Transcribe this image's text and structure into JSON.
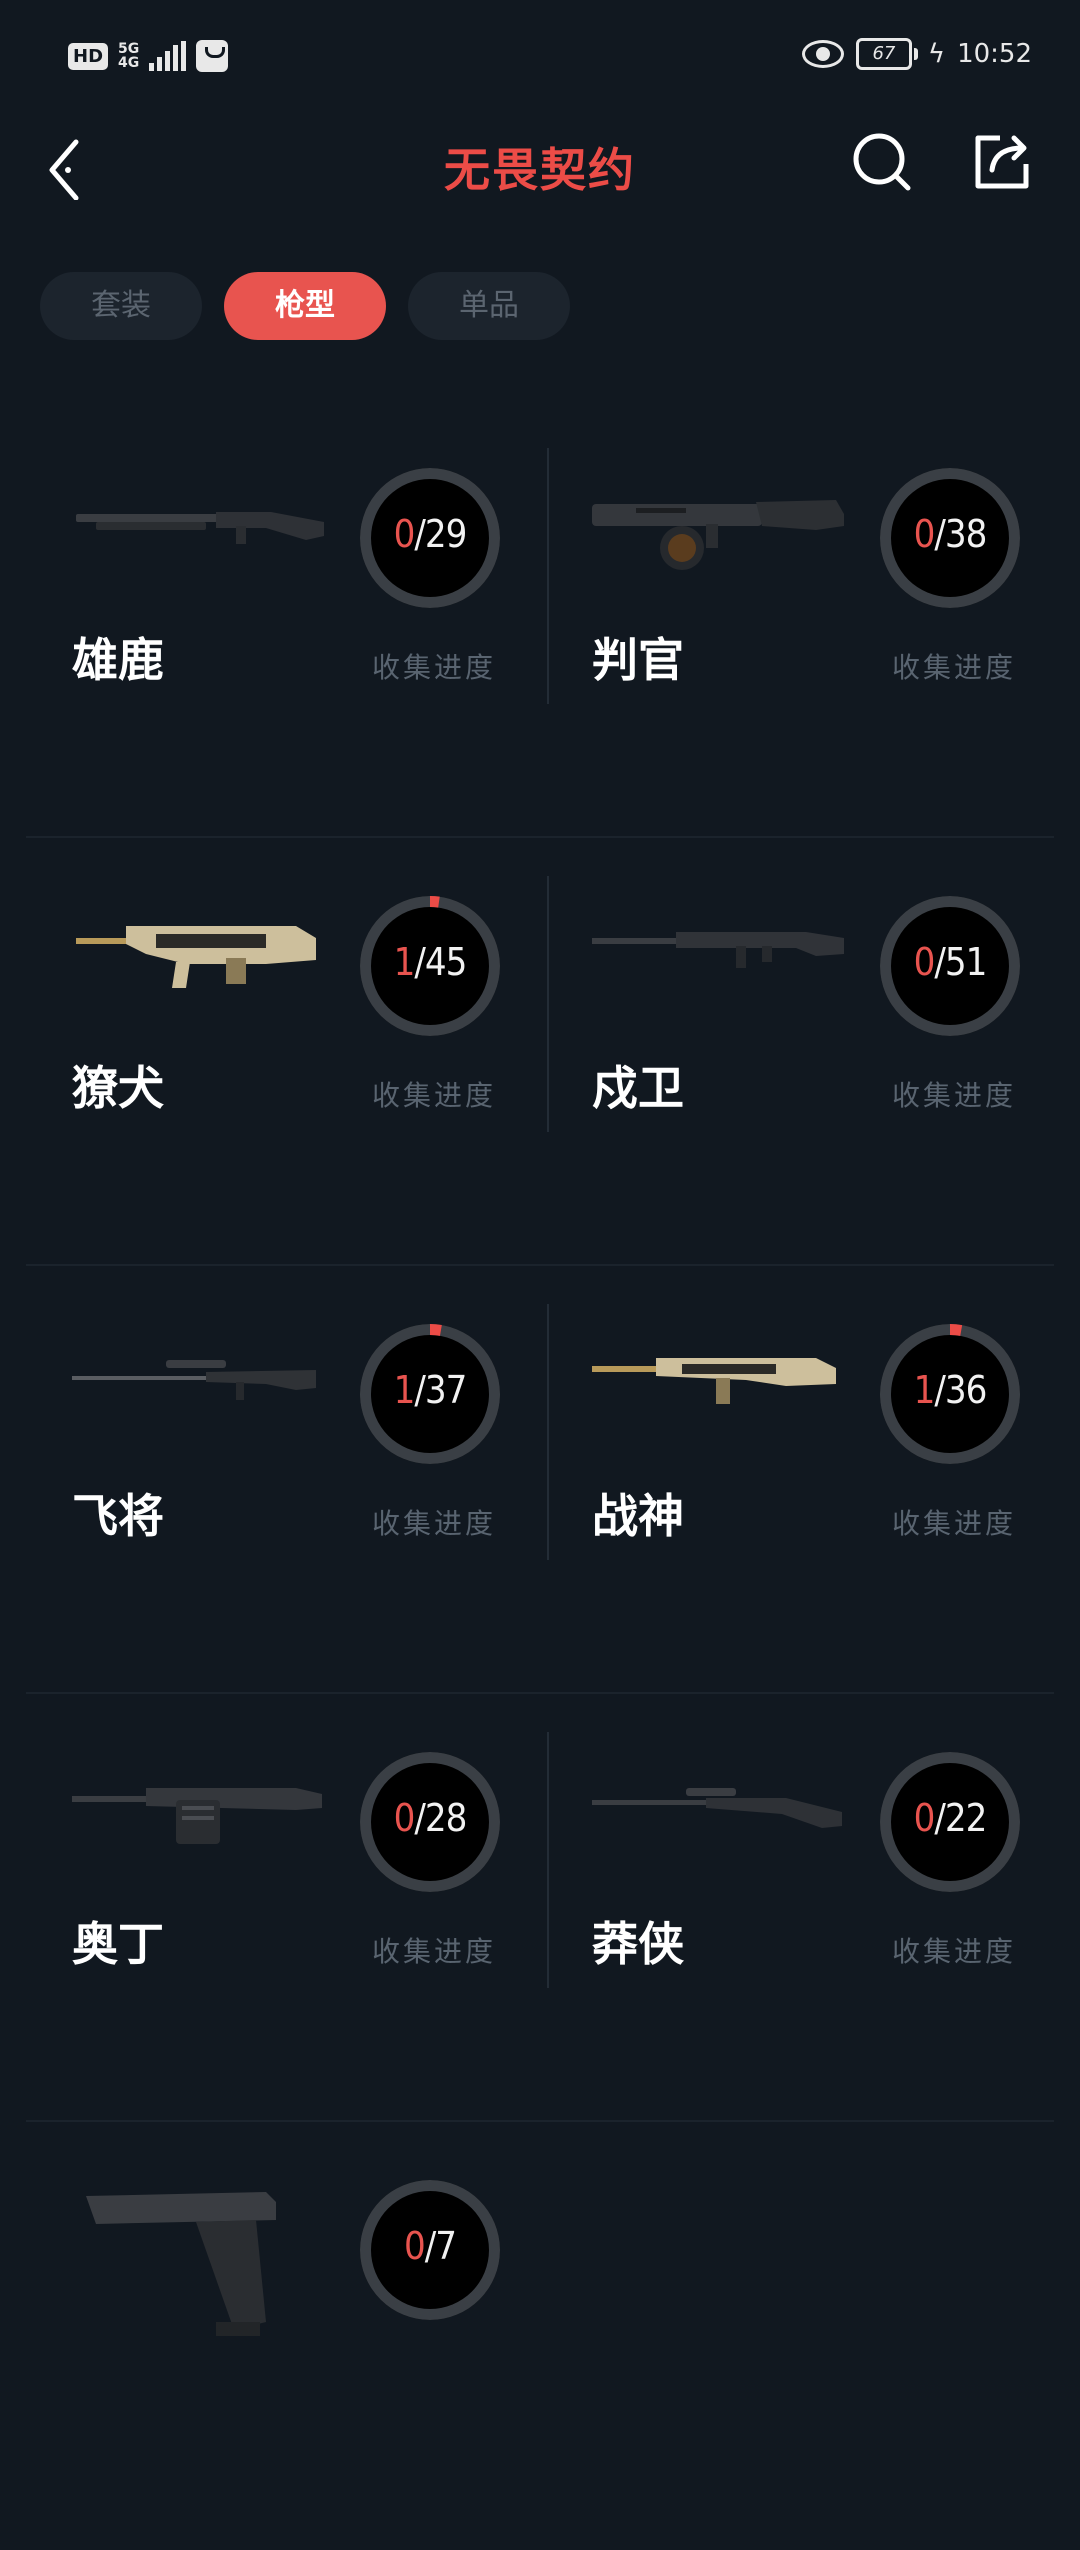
{
  "status_bar": {
    "hd": "HD",
    "net_top": "5G",
    "net_bottom": "4G",
    "battery": "67",
    "time": "10:52"
  },
  "header": {
    "title": "无畏契约",
    "accent_color": "#ec4c47"
  },
  "tabs": [
    {
      "label": "套装",
      "active": false
    },
    {
      "label": "枪型",
      "active": true
    },
    {
      "label": "单品",
      "active": false
    }
  ],
  "progress_label": "收集进度",
  "weapons": [
    {
      "name": "雄鹿",
      "collected": "0",
      "total": "/29",
      "icon": "shotgun-icon"
    },
    {
      "name": "判官",
      "collected": "0",
      "total": "/38",
      "icon": "drum-shotgun-icon"
    },
    {
      "name": "獠犬",
      "collected": "1",
      "total": "/45",
      "icon": "smg-icon"
    },
    {
      "name": "戍卫",
      "collected": "0",
      "total": "/51",
      "icon": "rifle-icon"
    },
    {
      "name": "飞将",
      "collected": "1",
      "total": "/37",
      "icon": "sniper-icon"
    },
    {
      "name": "战神",
      "collected": "1",
      "total": "/36",
      "icon": "light-machine-gun-icon"
    },
    {
      "name": "奥丁",
      "collected": "0",
      "total": "/28",
      "icon": "heavy-machine-gun-icon"
    },
    {
      "name": "莽侠",
      "collected": "0",
      "total": "/22",
      "icon": "scoped-rifle-icon"
    },
    {
      "name": "",
      "collected": "0",
      "total": "/7",
      "icon": "pistol-icon"
    }
  ]
}
